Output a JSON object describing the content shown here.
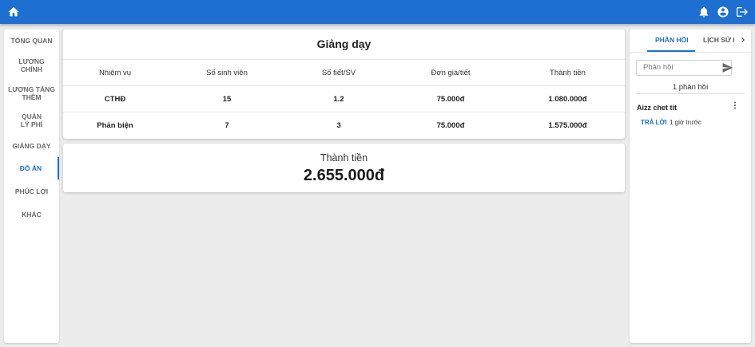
{
  "appbar": {
    "home_icon": "home-icon",
    "notification_icon": "bell-icon",
    "account_icon": "account-circle-icon",
    "logout_icon": "logout-icon",
    "color": "#1d6fd1"
  },
  "sidebar": {
    "items": [
      {
        "label": "TỔNG QUAN",
        "active": false
      },
      {
        "label": "LƯƠNG CHÍNH",
        "active": false
      },
      {
        "label": "LƯƠNG TĂNG THÊM",
        "active": false
      },
      {
        "label": "QUẢN LÝ PHÍ",
        "active": false
      },
      {
        "label": "GIẢNG DẠY",
        "active": false
      },
      {
        "label": "ĐỒ ÁN",
        "active": true
      },
      {
        "label": "PHÚC LỢI",
        "active": false
      },
      {
        "label": "KHÁC",
        "active": false
      }
    ]
  },
  "main": {
    "title": "Giảng dạy",
    "table": {
      "headers": [
        "Nhiệm vụ",
        "Số sinh viên",
        "Số tiết/SV",
        "Đơn giá/tiết",
        "Thành tiền"
      ],
      "rows": [
        [
          "CTHĐ",
          "15",
          "1.2",
          "75.000đ",
          "1.080.000đ"
        ],
        [
          "Phản biện",
          "7",
          "3",
          "75.000đ",
          "1.575.000đ"
        ]
      ]
    },
    "total": {
      "label": "Thành tiền",
      "value": "2.655.000đ"
    }
  },
  "right_panel": {
    "tabs": [
      {
        "label": "PHẢN HỒI",
        "active": true
      },
      {
        "label": "LỊCH SỬ I",
        "active": false
      }
    ],
    "next_icon": "chevron-right-icon",
    "feedback_placeholder": "Phản hồi",
    "send_icon": "send-icon",
    "feedback_count": "1 phản hồi",
    "comment": {
      "author": "Aizz chet tit",
      "more_icon": "more-vertical-icon",
      "reply_label": "TRẢ LỜI",
      "time": "1 giờ trước"
    }
  }
}
